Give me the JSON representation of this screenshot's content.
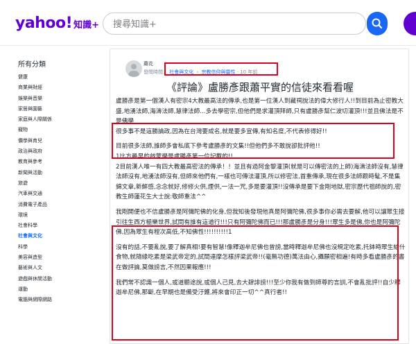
{
  "header": {
    "logo_main": "yahoo!",
    "logo_sub": "知識+",
    "search_placeholder": "搜尋知識+"
  },
  "sidebar": {
    "title": "所有分類",
    "items": [
      {
        "label": "健康"
      },
      {
        "label": "商業與財經"
      },
      {
        "label": "娛樂與音樂"
      },
      {
        "label": "家居與園藝"
      },
      {
        "label": "家庭與人際關係"
      },
      {
        "label": "寵物"
      },
      {
        "label": "價學與育兒"
      },
      {
        "label": "政治與政府"
      },
      {
        "label": "教育與參考"
      },
      {
        "label": "新聞與活動"
      },
      {
        "label": "旅遊"
      },
      {
        "label": "汽車與交通"
      },
      {
        "label": "消費電子產品"
      },
      {
        "label": "環境"
      },
      {
        "label": "社會科學"
      },
      {
        "label": "社會與文化",
        "active": true
      },
      {
        "label": "科學"
      },
      {
        "label": "美容與造型"
      },
      {
        "label": "藝術與人文"
      },
      {
        "label": "遊戲與休閒活動"
      },
      {
        "label": "運動"
      },
      {
        "label": "電腦與網際網路"
      }
    ]
  },
  "post": {
    "author": "蘿花",
    "meta_prefix": "發問時間：",
    "crumb_1": "社會與文化",
    "crumb_sep": "›",
    "crumb_2": "宗教信仰與靈性",
    "time_ago": "· 10 年前",
    "title": "《評論》盧勝彥跟蕭平實的信徒來看看喔",
    "paragraphs": [
      "盧勝彥是第一個漢人有密宗4大教最高法的傳承,也是第一位漢人到藏祠說法的偉大修行人!!到目前為止密教大盛,地湧法師,海濤法師,慧律法師...多去學密宗,但他們是求灌頂拜師,只有盧勝彥幫仁波切灌頂!!!並且佛法是不是佛學",
      "很多事不是這勝論政,因為在台灣要成名,就是要多宣傳,有知名度,不代表修得好!!",
      "",
      "目前很多法師,誰師多會私底下參考盧勝彥的文集!!但他們多不敢說卻批評他!!",
      "1比方最早的啟蒙學是盧勝彥第一位記載的!!",
      "2目前漢人唯一有四大教最高密法的傳承！！並且有過阿金黎灌頂(就是可以傳密法的上師)海濤法師沒有,慧律法師沒有,地湧法師沒有,但師來他們有,一樣也可傳法灌頂,所以修密法,首重傳承,現在很多法師跟時髦,不是集錦文章,新鮮感,念念就好,修修火供,煙供,一法一咒,多是要灌頂!!沒傳承是要下金剛地獄,密宗歷代祖師說的,密教生師蓮花生大士說:敬師重法^^",
      "",
      "我剛開便也不信盧勝彥是阿彌陀佛的化身,但我知後發現他真是阿彌陀佛,很多事你必需去要解,他可以讓眾生接引往生西方極樂世界,試問有誰有這道行!!!只有阿彌陀佛而已!!!那盧勝彥是分身!!!眾生多是佛,你也是阿彌陀佛,因為眾生有程次高低,不知佛性!!!!!!!!!!1",
      "",
      "沒有的話,不要亂說,要了解真相!要有智慧!像釋迦牟尼佛也曾謗,當時釋迦牟尼佛也沒規定吃素,托鉢時眾生給什食物,就隨緣吃素是梁武帝定的,試問達摩怎樣評梁武帝!!(毫無功德)萬法由心,攝願密相遍!有時多看盧勝彥的書在做評論,莫做謗言,不然因果報應!!!",
      "",
      "我們常不認識一個人,或道聽途說,或個人己見,去大肆誹謗!!!至少你我有做到師尊的言訓,不會亂批評!!自少釋迦牟尼佛,那斷,在早期也是備受汙鑊,將來會印正一切^^真行者!!"
    ]
  }
}
